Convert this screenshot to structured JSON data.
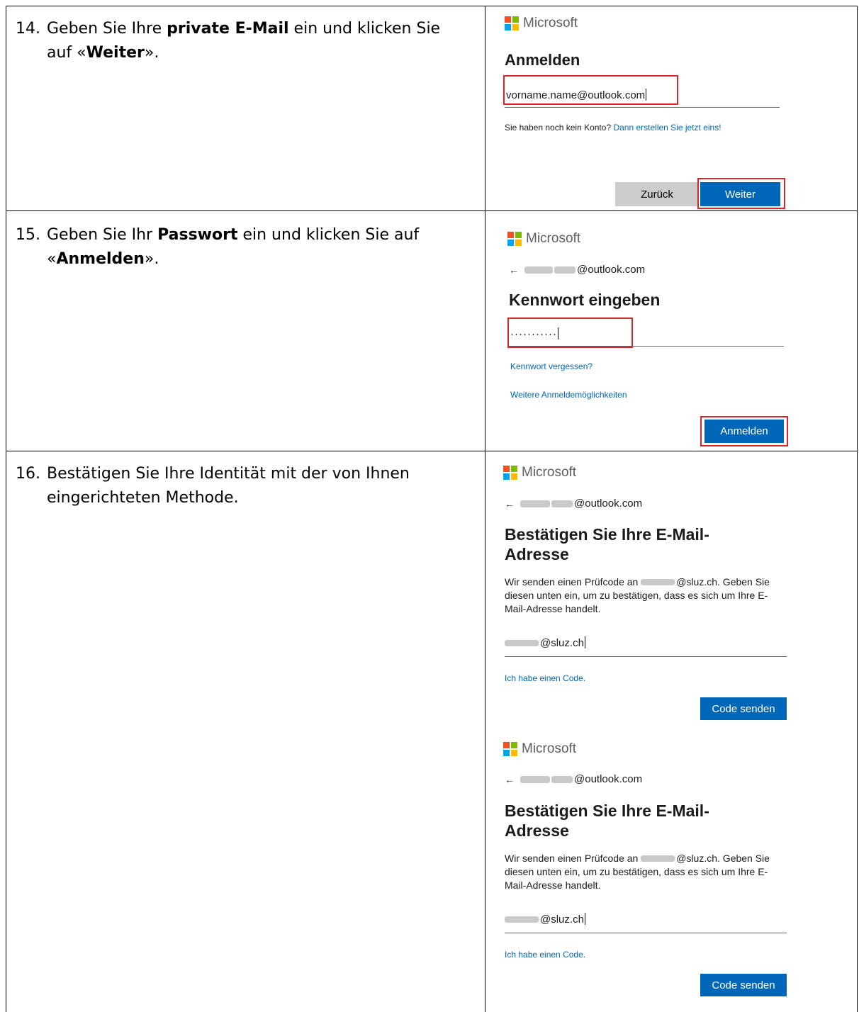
{
  "colors": {
    "ms_red": "#f25022",
    "ms_green": "#7fba00",
    "ms_blue": "#00a4ef",
    "ms_yellow": "#ffb900",
    "accent_blue": "#0067b8",
    "highlight_red": "#d9252c"
  },
  "steps": [
    {
      "number": "14.",
      "pre": "Geben Sie Ihre ",
      "bold1": "private E-Mail",
      "mid": " ein und klicken Sie auf «",
      "bold2": "Weiter",
      "post": "»."
    },
    {
      "number": "15.",
      "pre": "Geben Sie Ihr ",
      "bold1": "Passwort",
      "mid": " ein und klicken Sie auf «",
      "bold2": "Anmelden",
      "post": "»."
    },
    {
      "number": "16.",
      "text": "Bestätigen Sie Ihre Identität mit der von Ihnen eingerichteten Methode."
    }
  ],
  "brand": "Microsoft",
  "signin": {
    "title": "Anmelden",
    "email_value": "vorname.name@outlook.com",
    "no_account": "Sie haben noch kein Konto?",
    "create_link": "Dann erstellen Sie jetzt eins!",
    "back_button": "Zurück",
    "next_button": "Weiter"
  },
  "password": {
    "account_suffix": "@outlook.com",
    "title": "Kennwort eingeben",
    "password_dots": "···········",
    "forgot_link": "Kennwort vergessen?",
    "options_link": "Weitere Anmeldemöglichkeiten",
    "signin_button": "Anmelden"
  },
  "verify": {
    "account_suffix": "@outlook.com",
    "title_line1": "Bestätigen Sie Ihre E-Mail-",
    "title_line2": "Adresse",
    "body_pre": "Wir senden einen Prüfcode an ",
    "body_post": "@sluz.ch. Geben Sie diesen unten ein, um zu bestätigen, dass es sich um Ihre E-Mail-Adresse handelt.",
    "email_suffix": "@sluz.ch",
    "have_code_link": "Ich habe einen Code.",
    "send_button": "Code senden"
  }
}
